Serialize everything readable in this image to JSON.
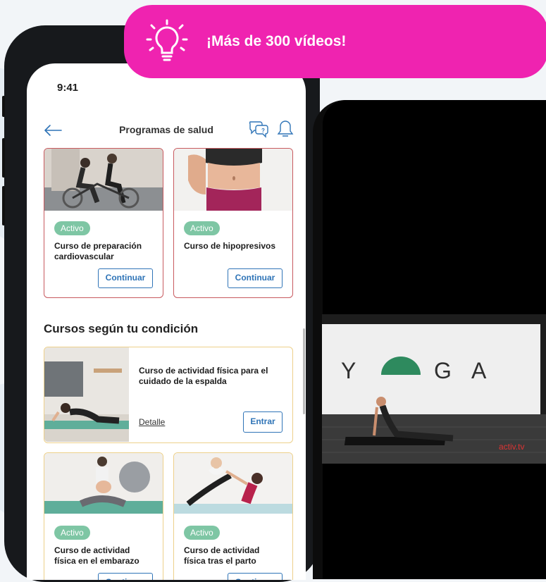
{
  "banner": {
    "text": "¡Más de 300 vídeos!",
    "icon": "lightbulb-icon",
    "color": "#ef23b0"
  },
  "status_bar": {
    "time": "9:41"
  },
  "nav": {
    "title": "Programas de salud",
    "back_icon": "arrow-left-icon",
    "chat_icon": "chat-bubbles-icon",
    "bell_icon": "bell-icon"
  },
  "active_courses": [
    {
      "badge": "Activo",
      "title_line1": "Curso de preparación",
      "title_line2": "cardiovascular",
      "button": "Continuar"
    },
    {
      "badge": "Activo",
      "title_line1": "Curso de hipopresivos",
      "title_line2": "",
      "button": "Continuar"
    }
  ],
  "condition_section": {
    "title": "Cursos según tu condición",
    "featured": {
      "title_line1": "Curso de actividad física para el",
      "title_line2": "cuidado de la espalda",
      "detail_link": "Detalle",
      "enter_button": "Entrar"
    },
    "cards": [
      {
        "badge": "Activo",
        "title_line1": "Curso de actividad",
        "title_line2": "física en el embarazo",
        "button": "Continuar"
      },
      {
        "badge": "Activo",
        "title_line1": "Curso de actividad",
        "title_line2": "física tras el parto",
        "button": "Continuar"
      }
    ]
  },
  "video": {
    "letters": [
      "Y",
      "G",
      "A"
    ],
    "brand": "activ.tv"
  },
  "colors": {
    "accent_blue": "#2f74b7",
    "badge_green": "#7ec6a4",
    "card_red": "#c85a5f",
    "card_yellow": "#edd08a"
  }
}
